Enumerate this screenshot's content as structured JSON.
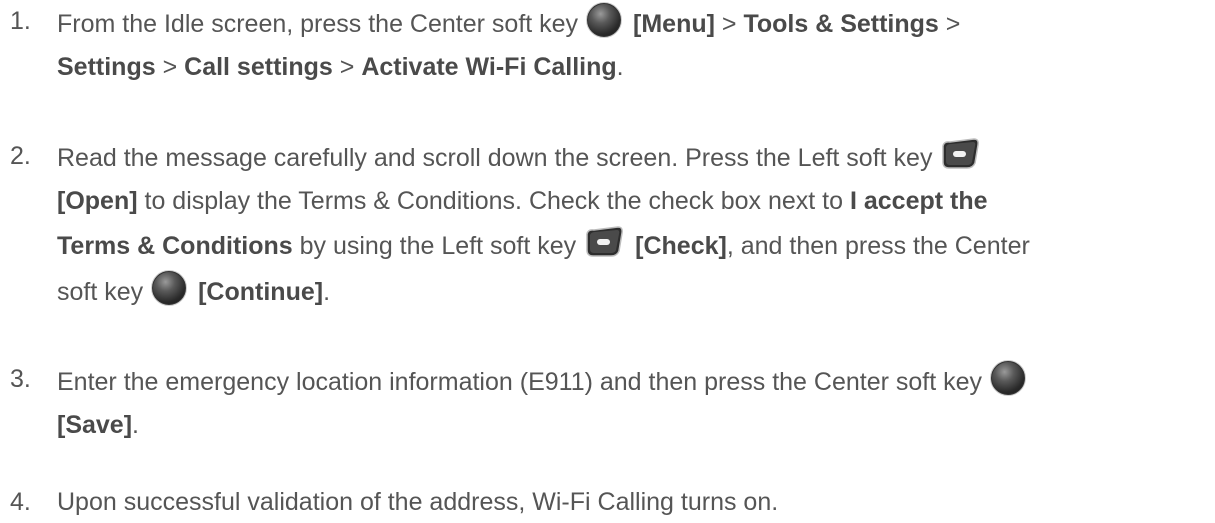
{
  "icons": {
    "center_key": "center-soft-key-icon",
    "left_key": "left-soft-key-icon"
  },
  "steps": [
    {
      "number": "1.",
      "line1": {
        "a": "From the Idle screen, press the Center soft key",
        "b": "[Menu]",
        "c": ">",
        "d": "Tools & Settings",
        "e": ">"
      },
      "line2": {
        "a": "Settings",
        "b": ">",
        "c": "Call settings",
        "d": ">",
        "e": "Activate Wi-Fi Calling",
        "f": "."
      }
    },
    {
      "number": "2.",
      "line1": {
        "a": "Read the message carefully and scroll down the screen. Press the Left soft key"
      },
      "line2": {
        "a": "[Open]",
        "b": "to display the Terms & Conditions. Check the check box next to",
        "c": "I accept the"
      },
      "line3": {
        "a": "Terms & Conditions",
        "b": "by using the Left soft key",
        "c": "[Check]",
        "d": ", and then press the Center"
      },
      "line4": {
        "a": "soft key",
        "b": "[Continue]",
        "c": "."
      }
    },
    {
      "number": "3.",
      "line1": {
        "a": "Enter the emergency location information (E911) and then press the Center soft key"
      },
      "line2": {
        "a": "[Save]",
        "b": "."
      }
    },
    {
      "number": "4.",
      "line1": {
        "a": "Upon successful validation of the address, Wi-Fi Calling turns on."
      }
    }
  ]
}
